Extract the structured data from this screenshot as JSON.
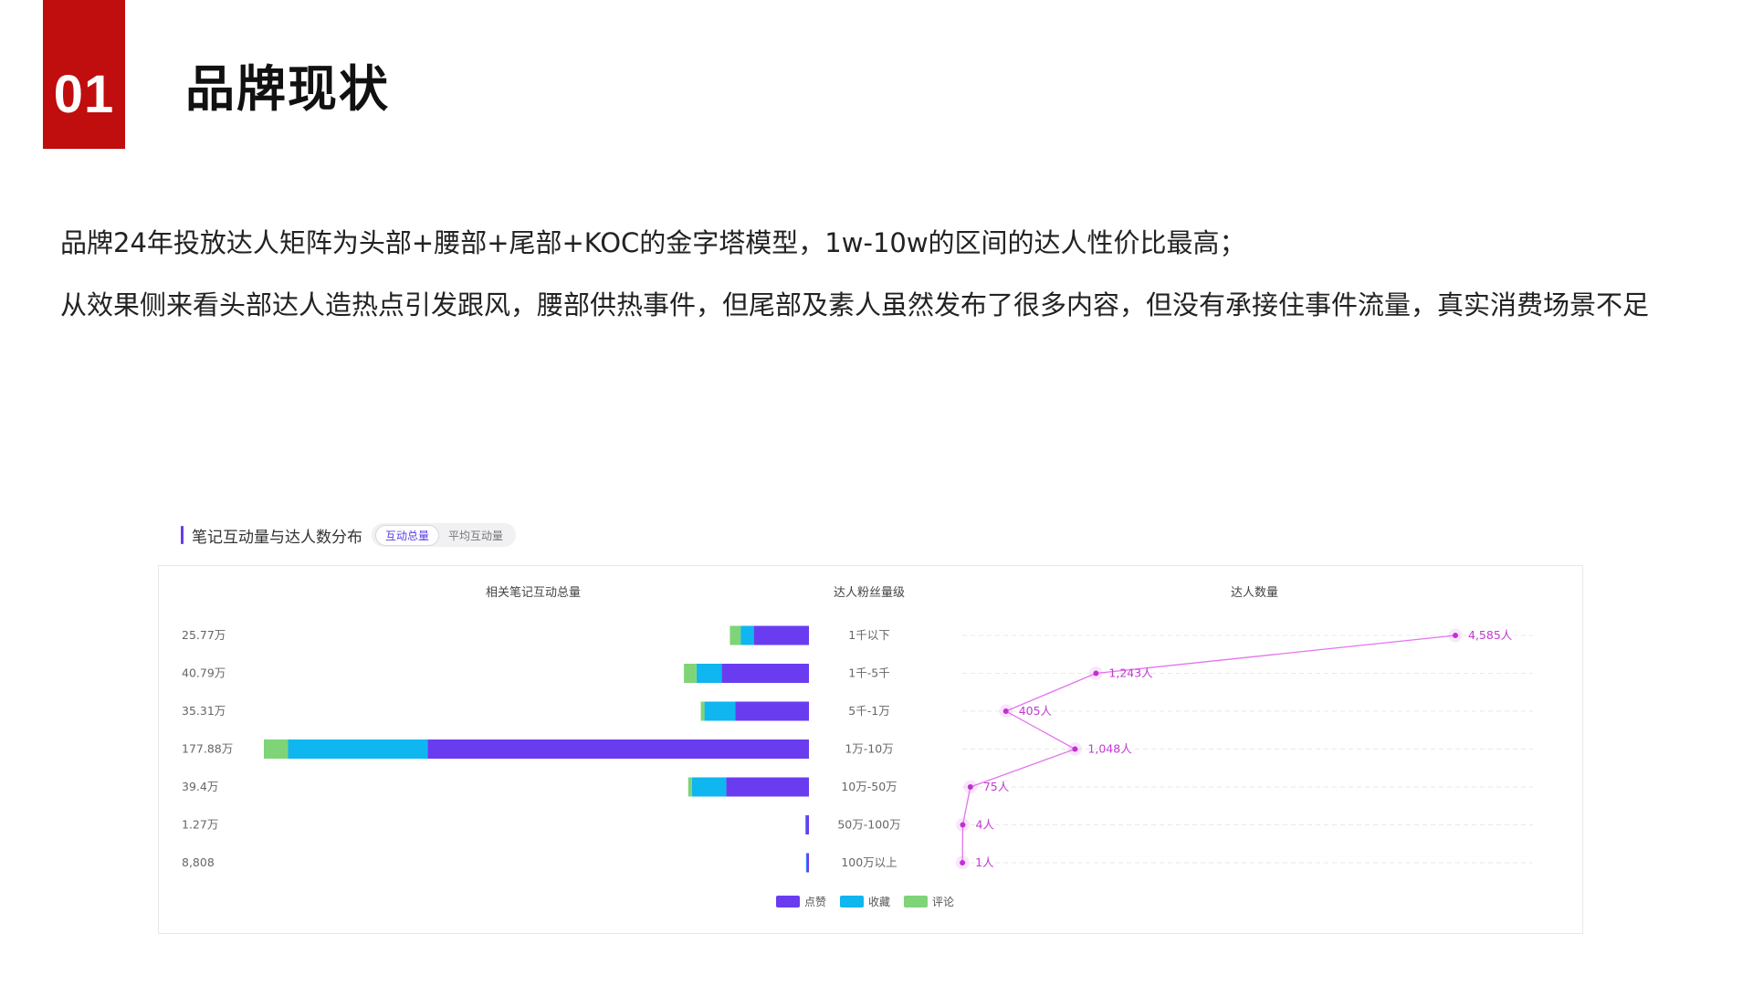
{
  "header": {
    "section_number": "01",
    "title": "品牌现状"
  },
  "body": {
    "paragraph_1": "品牌24年投放达人矩阵为头部+腰部+尾部+KOC的金字塔模型，1w-10w的区间的达人性价比最高；",
    "paragraph_2": "从效果侧来看头部达人造热点引发跟风，腰部供热事件，但尾部及素人虽然发布了很多内容，但没有承接住事件流量，真实消费场景不足"
  },
  "chart_header": {
    "title": "笔记互动量与达人数分布",
    "toggle_active": "互动总量",
    "toggle_inactive": "平均互动量"
  },
  "colors": {
    "brand_red": "#c00d0d",
    "likes": "#6a3cf0",
    "collects": "#0fb6ef",
    "comments": "#7ed477",
    "count_line": "#e374ee",
    "count_point": "#c22fd3"
  },
  "chart_data": {
    "type": "bar",
    "headers": {
      "left": "相关笔记互动总量",
      "middle": "达人粉丝量级",
      "right": "达人数量"
    },
    "categories": [
      "1千以下",
      "1千-5千",
      "5千-1万",
      "1万-10万",
      "10万-50万",
      "50万-100万",
      "100万以上"
    ],
    "totals_labels": [
      "25.77万",
      "40.79万",
      "35.31万",
      "177.88万",
      "39.4万",
      "1.27万",
      "8,808"
    ],
    "stack_series": [
      {
        "name": "点赞",
        "values": [
          18.0,
          28.5,
          24.0,
          124.5,
          27.0,
          0.9,
          0.6
        ]
      },
      {
        "name": "收藏",
        "values": [
          4.3,
          8.2,
          10.1,
          45.5,
          11.2,
          0.3,
          0.2
        ]
      },
      {
        "name": "评论",
        "values": [
          3.5,
          4.1,
          1.2,
          7.9,
          1.2,
          0.07,
          0.08
        ]
      }
    ],
    "count_series": {
      "type": "line",
      "values": [
        4585,
        1243,
        405,
        1048,
        75,
        4,
        1
      ],
      "labels": [
        "4,585人",
        "1,243人",
        "405人",
        "1,048人",
        "75人",
        "4人",
        "1人"
      ]
    },
    "legend": [
      "点赞",
      "收藏",
      "评论"
    ],
    "legend_position": "bottom-center",
    "grid": true
  }
}
